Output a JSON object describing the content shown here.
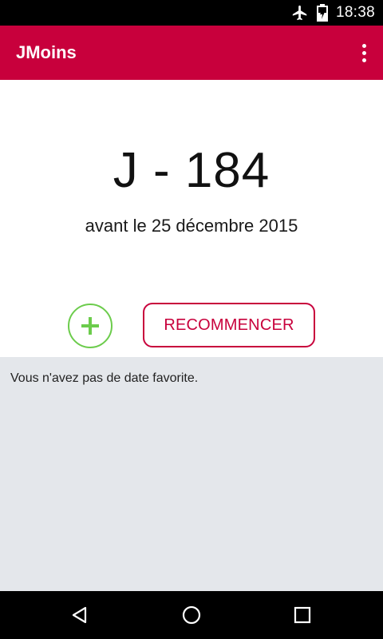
{
  "status_bar": {
    "time": "18:38",
    "icons": [
      "airplane-icon",
      "battery-charging-icon"
    ]
  },
  "app_bar": {
    "title": "JMoins",
    "menu_icon": "overflow-menu-icon"
  },
  "countdown": {
    "value": "J - 184",
    "subtitle": "avant le 25 décembre 2015"
  },
  "actions": {
    "add_icon": "plus-icon",
    "accent_add": "#6ccc4c",
    "reset_label": "RECOMMENCER",
    "accent_reset": "#c8003c"
  },
  "favorites": {
    "empty_message": "Vous n'avez pas de date favorite."
  },
  "nav_bar": {
    "icons": [
      "back-icon",
      "home-icon",
      "recents-icon"
    ]
  },
  "colors": {
    "primary": "#c8003c",
    "favorites_bg": "#e4e7eb"
  }
}
